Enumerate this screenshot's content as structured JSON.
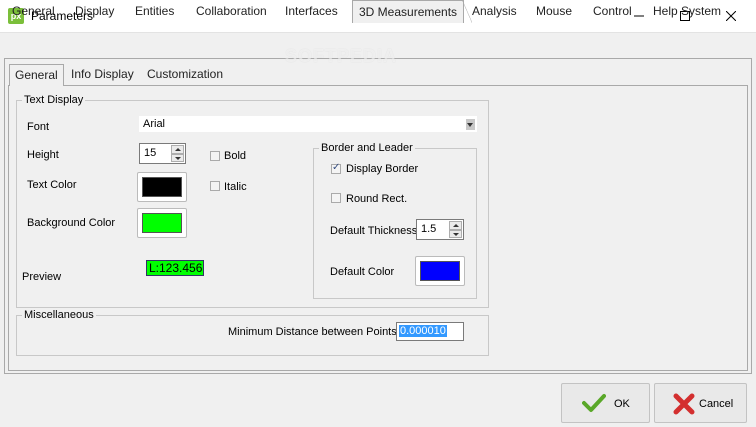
{
  "window": {
    "title": "Parameters",
    "app_icon_text": "px"
  },
  "main_tabs": [
    {
      "label": "General"
    },
    {
      "label": "Display"
    },
    {
      "label": "Entities"
    },
    {
      "label": "Collaboration"
    },
    {
      "label": "Interfaces"
    },
    {
      "label": "3D Measurements"
    },
    {
      "label": "Analysis"
    },
    {
      "label": "Mouse"
    },
    {
      "label": "Control"
    },
    {
      "label": "Help System"
    }
  ],
  "sub_tabs": [
    {
      "label": "General"
    },
    {
      "label": "Info Display"
    },
    {
      "label": "Customization"
    }
  ],
  "text_display": {
    "group_label": "Text Display",
    "font_label": "Font",
    "font_value": "Arial",
    "height_label": "Height",
    "height_value": "15",
    "bold_label": "Bold",
    "italic_label": "Italic",
    "text_color_label": "Text Color",
    "text_color": "#000000",
    "background_color_label": "Background Color",
    "background_color": "#00ff00",
    "preview_label": "Preview",
    "preview_text": "L:123.456"
  },
  "border_leader": {
    "group_label": "Border and Leader",
    "display_border_label": "Display Border",
    "display_border_checked": true,
    "round_rect_label": "Round Rect.",
    "round_rect_checked": false,
    "default_thickness_label": "Default Thickness",
    "default_thickness_value": "1.5",
    "default_color_label": "Default Color",
    "default_color": "#0000ff"
  },
  "misc": {
    "group_label": "Miscellaneous",
    "min_distance_label": "Minimum Distance between Points",
    "min_distance_value": "0.000010"
  },
  "footer": {
    "ok_label": "OK",
    "cancel_label": "Cancel"
  },
  "watermark": "SOFTPEDIA"
}
